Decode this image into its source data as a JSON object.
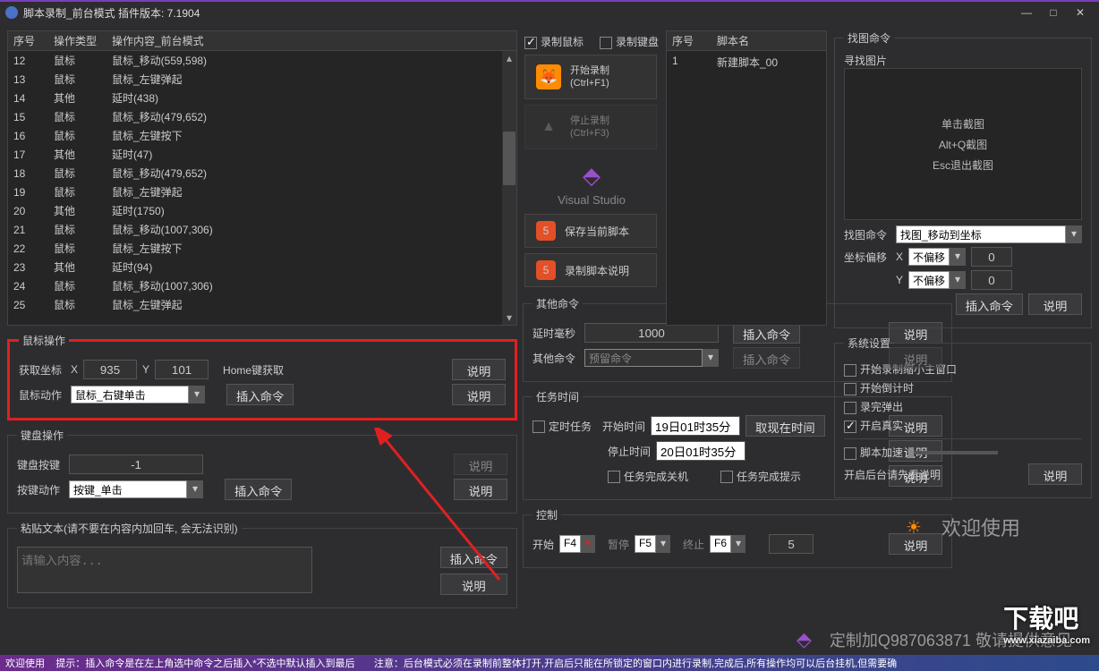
{
  "title": "脚本录制_前台模式  插件版本:  7.1904",
  "win": {
    "min": "—",
    "max": "□",
    "close": "✕"
  },
  "table": {
    "headers": [
      "序号",
      "操作类型",
      "操作内容_前台模式"
    ],
    "rows": [
      {
        "no": "12",
        "type": "鼠标",
        "content": "鼠标_移动(559,598)"
      },
      {
        "no": "13",
        "type": "鼠标",
        "content": "鼠标_左键弹起"
      },
      {
        "no": "14",
        "type": "其他",
        "content": "延时(438)"
      },
      {
        "no": "15",
        "type": "鼠标",
        "content": "鼠标_移动(479,652)"
      },
      {
        "no": "16",
        "type": "鼠标",
        "content": "鼠标_左键按下"
      },
      {
        "no": "17",
        "type": "其他",
        "content": "延时(47)"
      },
      {
        "no": "18",
        "type": "鼠标",
        "content": "鼠标_移动(479,652)"
      },
      {
        "no": "19",
        "type": "鼠标",
        "content": "鼠标_左键弹起"
      },
      {
        "no": "20",
        "type": "其他",
        "content": "延时(1750)"
      },
      {
        "no": "21",
        "type": "鼠标",
        "content": "鼠标_移动(1007,306)"
      },
      {
        "no": "22",
        "type": "鼠标",
        "content": "鼠标_左键按下"
      },
      {
        "no": "23",
        "type": "其他",
        "content": "延时(94)"
      },
      {
        "no": "24",
        "type": "鼠标",
        "content": "鼠标_移动(1007,306)"
      },
      {
        "no": "25",
        "type": "鼠标",
        "content": "鼠标_左键弹起"
      }
    ]
  },
  "record": {
    "rec_mouse": "录制鼠标",
    "rec_keyboard": "录制键盘",
    "start": "开始录制",
    "start_key": "(Ctrl+F1)",
    "stop": "停止录制",
    "stop_key": "(Ctrl+F3)",
    "vs": "Visual Studio",
    "save": "保存当前脚本",
    "help": "录制脚本说明"
  },
  "scripts": {
    "hd1": "序号",
    "hd2": "脚本名",
    "row_no": "1",
    "row_name": "新建脚本_00"
  },
  "mouseop": {
    "legend": "鼠标操作",
    "get_coord": "获取坐标",
    "x": "X",
    "xv": "935",
    "y": "Y",
    "yv": "101",
    "home": "Home键获取",
    "btn_help": "说明",
    "action": "鼠标动作",
    "action_val": "鼠标_右键单击",
    "insert": "插入命令"
  },
  "keyop": {
    "legend": "键盘操作",
    "key": "键盘按键",
    "keyv": "-1",
    "action": "按键动作",
    "action_val": "按键_单击",
    "insert": "插入命令",
    "help": "说明"
  },
  "paste": {
    "legend": "粘贴文本(请不要在内容内加回车, 会无法识别)",
    "placeholder": "请输入内容...",
    "insert": "插入命令",
    "help": "说明"
  },
  "other": {
    "legend": "其他命令",
    "delay": "延时毫秒",
    "delay_val": "1000",
    "cmd": "其他命令",
    "cmd_val": "预留命令",
    "insert": "插入命令",
    "help": "说明"
  },
  "task": {
    "legend": "任务时间",
    "timed": "定时任务",
    "start_label": "开始时间",
    "start_val": "19日01时35分",
    "get_now": "取现在时间",
    "help": "说明",
    "stop_label": "停止时间",
    "stop_val": "20日01时35分",
    "shutdown": "任务完成关机",
    "notify": "任务完成提示"
  },
  "control": {
    "legend": "控制",
    "start": "开始",
    "start_key": "F4",
    "pause": "暂停",
    "pause_key": "F5",
    "stop": "终止",
    "stop_key": "F6",
    "count": "5",
    "help": "说明"
  },
  "findimg": {
    "legend": "找图命令",
    "find_pic": "寻找图片",
    "click_cap": "单击截图",
    "altq": "Alt+Q截图",
    "esc": "Esc退出截图",
    "cmd_label": "找图命令",
    "cmd_val": "找图_移动到坐标",
    "offset": "坐标偏移",
    "x": "X",
    "y": "Y",
    "no_offset": "不偏移",
    "zero": "0",
    "insert": "插入命令",
    "help": "说明"
  },
  "sys": {
    "legend": "系统设置",
    "c1": "开始录制缩小主窗口",
    "c2": "开始倒计时",
    "c3": "录完弹出",
    "c4": "开启真实",
    "accel": "脚本加速",
    "bg_hint": "开启后台请先看说明",
    "help": "说明"
  },
  "welcome": "欢迎使用",
  "custom": "定制加Q987063871  敬请提供意见",
  "footer1": "欢迎使用",
  "footer2": "提示：插入命令是在左上角选中命令之后插入*不选中默认插入到最后",
  "footer3": "注意：后台模式必须在录制前整体打开,开启后只能在所锁定的窗口内进行录制,完成后,所有操作均可以后台挂机,但需要确",
  "watermark": "下载吧",
  "watermark_url": "www.xiazaiba.com"
}
